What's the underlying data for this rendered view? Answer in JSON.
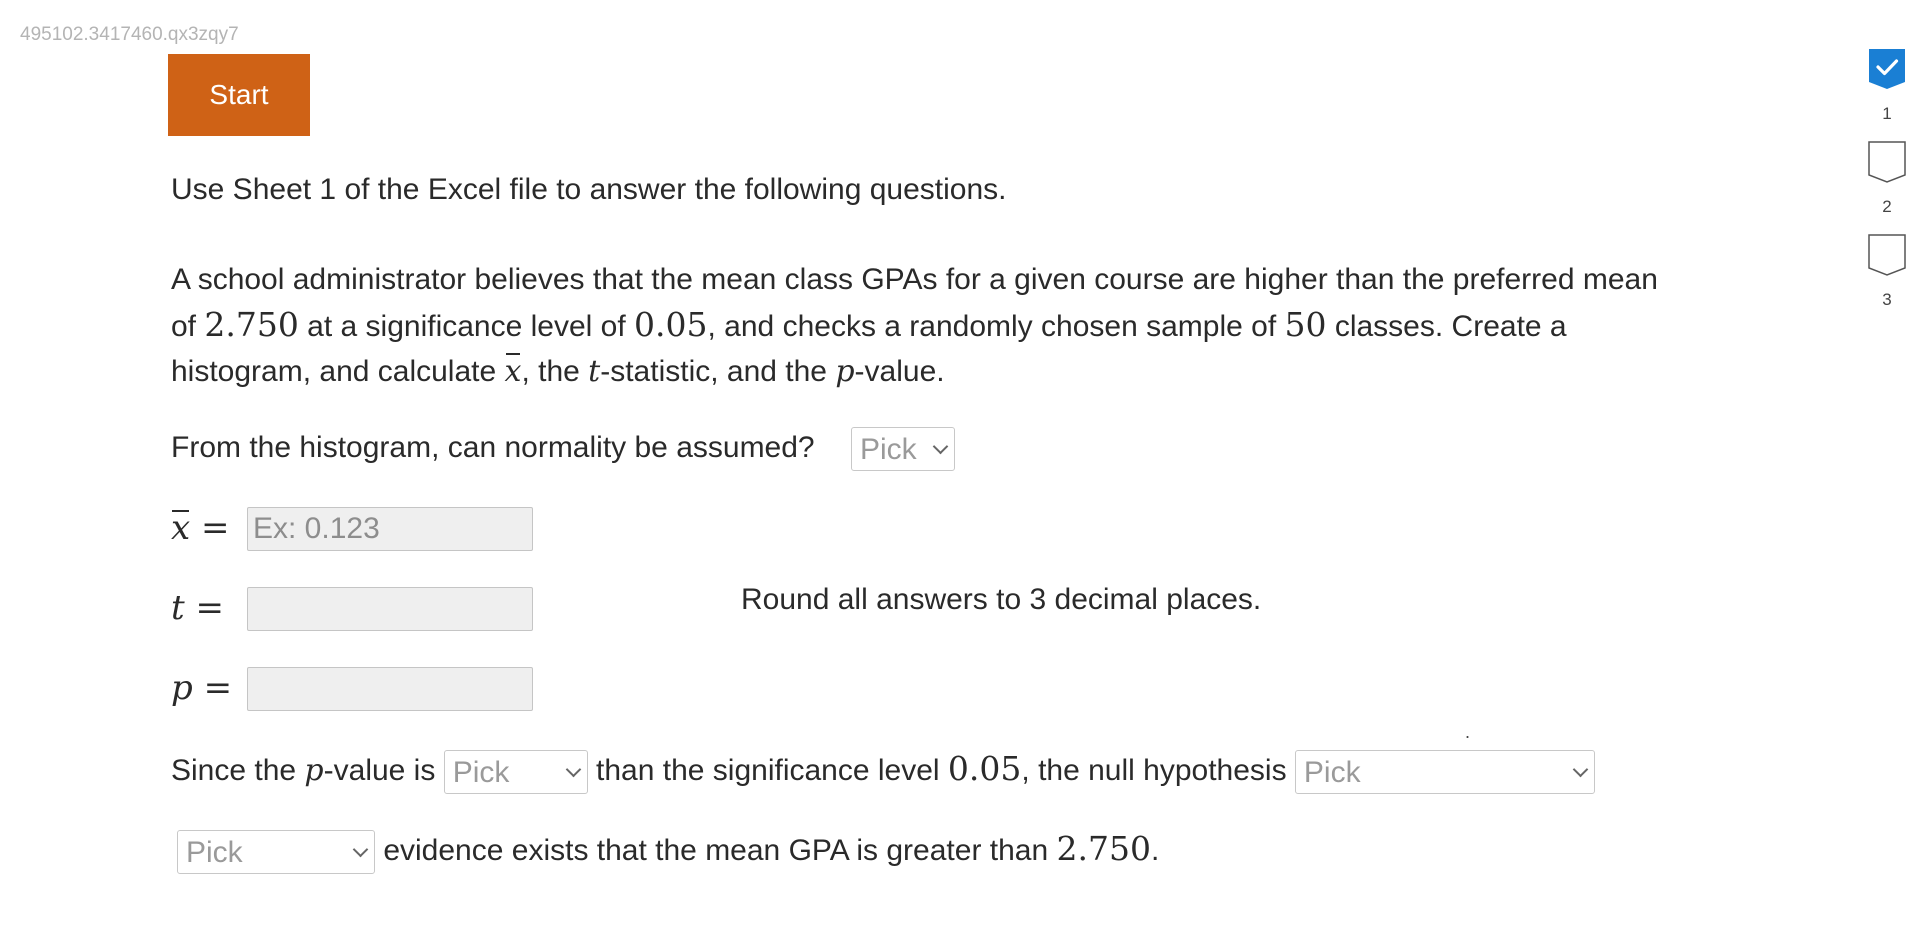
{
  "session_id": "495102.3417460.qx3zqy7",
  "start_button": "Start",
  "intro": "Use Sheet 1 of the Excel file to answer the following questions.",
  "problem": {
    "p1": "A school administrator believes that the mean class GPAs for a given course are higher than the preferred mean of ",
    "mean": "2.750",
    "p2": " at a significance level of ",
    "alpha": "0.05",
    "p3": ", and checks a randomly chosen sample of ",
    "n": "50",
    "p4": " classes. Create a histogram, and calculate ",
    "xbar": "x",
    "p5": ", the ",
    "t_sym": "t",
    "p6": "-statistic, and the ",
    "p_sym": "p",
    "p7": "-value."
  },
  "normality": {
    "question": "From the histogram, can normality be assumed?",
    "selected": "Pick"
  },
  "fields": {
    "xbar": {
      "label": "x",
      "eq": " =",
      "placeholder": "Ex: 0.123",
      "value": ""
    },
    "t": {
      "label": "t",
      "eq": " =",
      "placeholder": "",
      "value": ""
    },
    "p": {
      "label": "p",
      "eq": " =",
      "placeholder": "",
      "value": ""
    }
  },
  "round_note": "Round all answers to 3 decimal places.",
  "conclusion": {
    "s1": "Since the ",
    "p_sym": "p",
    "s2": "-value is ",
    "compare_selected": "Pick",
    "s3": " than the significance level ",
    "alpha": "0.05",
    "s4": ", the null hypothesis ",
    "hypothesis_selected": "Pick",
    "dot": ".",
    "evidence_selected": "Pick",
    "s5": " evidence exists that the mean GPA is greater than ",
    "mean": "2.750",
    "s6": "."
  },
  "progress": [
    {
      "num": "1",
      "status": "complete"
    },
    {
      "num": "2",
      "status": "incomplete"
    },
    {
      "num": "3",
      "status": "incomplete"
    }
  ],
  "colors": {
    "start_button": "#cf6216",
    "progress_complete": "#1a7fd4",
    "input_background": "#efefef"
  }
}
